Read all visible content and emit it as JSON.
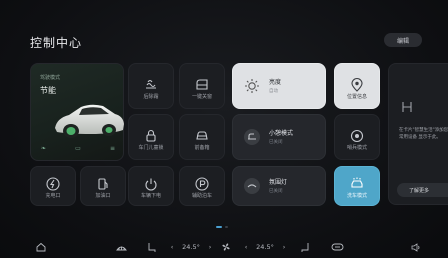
{
  "header": {
    "title": "控制中心",
    "edit_label": "编辑"
  },
  "car": {
    "mode_label": "驾驶模式",
    "mode_value": "节能",
    "icons": [
      "leaf-icon",
      "car-icon",
      "pedal-icon"
    ]
  },
  "tiles": {
    "rear_wiper": "后除霜",
    "one_key": "一键关窗",
    "child_lock": "车门儿童锁",
    "rear_trunk": "前备箱",
    "charge_port": "充电口",
    "fuel_port": "加油口",
    "power_off": "车辆下电",
    "parking": "辅助泊车",
    "sentry": "哨兵模式",
    "car_wash": "洗车模式"
  },
  "wide": {
    "light": {
      "title": "亮度",
      "sub": "自动"
    },
    "location": {
      "title": "位置信息"
    },
    "sleep": {
      "title": "小憩模式",
      "sub": "已关闭"
    },
    "ambient": {
      "title": "氛围灯",
      "sub": "已关闭"
    }
  },
  "right_panel": {
    "text": "在卡片\"智慧生活\"添加您的常用设备\n显示于此。",
    "button": "了解更多"
  },
  "bottom_bar": {
    "left_temp": "24.5°",
    "right_temp": "24.5°"
  },
  "colors": {
    "accent": "#4fa6c9",
    "page_dot": "#4a9fd0"
  }
}
